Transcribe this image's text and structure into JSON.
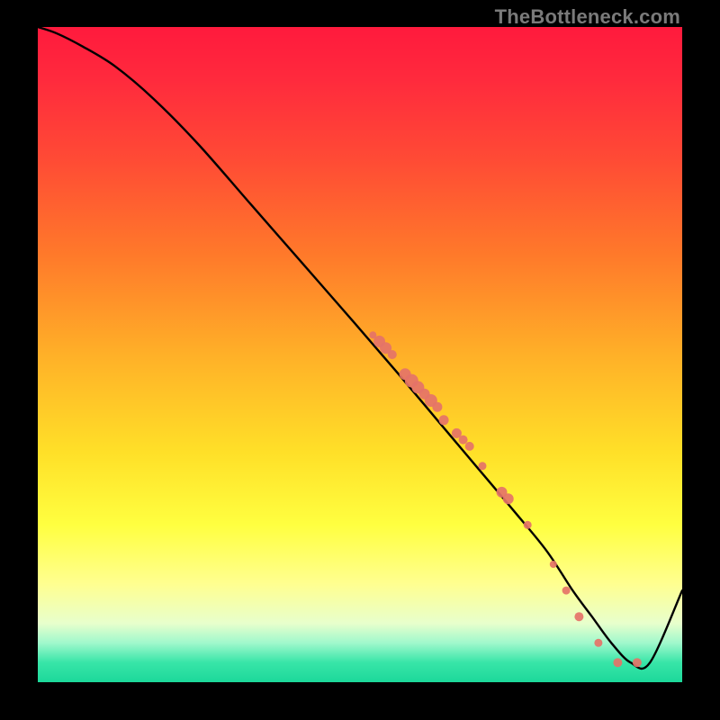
{
  "watermark": "TheBottleneck.com",
  "chart_data": {
    "type": "line",
    "title": "",
    "xlabel": "",
    "ylabel": "",
    "xlim": [
      0,
      100
    ],
    "ylim": [
      0,
      100
    ],
    "grid": false,
    "legend": null,
    "line": {
      "name": "bottleneck-curve",
      "x": [
        0,
        3,
        7,
        12,
        18,
        25,
        33,
        41,
        49,
        56,
        62,
        68,
        74,
        79,
        83,
        86,
        89,
        92,
        95,
        100
      ],
      "y": [
        100,
        99,
        97,
        94,
        89,
        82,
        73,
        64,
        55,
        47,
        40,
        33,
        26,
        20,
        14,
        10,
        6,
        3,
        3,
        14
      ]
    },
    "scatter": {
      "name": "highlighted-points",
      "color": "#e57368",
      "points": [
        {
          "x": 52,
          "y": 53,
          "r": 4.0
        },
        {
          "x": 53,
          "y": 52,
          "r": 6.5
        },
        {
          "x": 54,
          "y": 51,
          "r": 6.5
        },
        {
          "x": 55,
          "y": 50,
          "r": 5.0
        },
        {
          "x": 57,
          "y": 47,
          "r": 6.5
        },
        {
          "x": 58,
          "y": 46,
          "r": 7.5
        },
        {
          "x": 59,
          "y": 45,
          "r": 7.0
        },
        {
          "x": 60,
          "y": 44,
          "r": 6.0
        },
        {
          "x": 61,
          "y": 43,
          "r": 7.0
        },
        {
          "x": 62,
          "y": 42,
          "r": 5.5
        },
        {
          "x": 63,
          "y": 40,
          "r": 5.5
        },
        {
          "x": 65,
          "y": 38,
          "r": 5.5
        },
        {
          "x": 66,
          "y": 37,
          "r": 5.0
        },
        {
          "x": 67,
          "y": 36,
          "r": 5.0
        },
        {
          "x": 69,
          "y": 33,
          "r": 4.5
        },
        {
          "x": 72,
          "y": 29,
          "r": 6.0
        },
        {
          "x": 73,
          "y": 28,
          "r": 6.0
        },
        {
          "x": 76,
          "y": 24,
          "r": 4.5
        },
        {
          "x": 80,
          "y": 18,
          "r": 4.0
        },
        {
          "x": 82,
          "y": 14,
          "r": 4.5
        },
        {
          "x": 84,
          "y": 10,
          "r": 5.0
        },
        {
          "x": 87,
          "y": 6,
          "r": 4.5
        },
        {
          "x": 90,
          "y": 3,
          "r": 5.0
        },
        {
          "x": 93,
          "y": 3,
          "r": 5.0
        }
      ]
    }
  }
}
